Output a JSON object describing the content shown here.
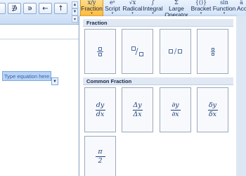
{
  "ribbon": {
    "symbols": [
      "∌",
      "∍",
      "←",
      "↑"
    ],
    "structures": [
      {
        "label": "Fraction",
        "icon": "x/y",
        "active": true
      },
      {
        "label": "Script",
        "icon": "eˣ"
      },
      {
        "label": "Radical",
        "icon": "√x"
      },
      {
        "label": "Integral",
        "icon": "∫"
      },
      {
        "label": "Large",
        "label2": "Operator",
        "icon": "Σ"
      },
      {
        "label": "Bracket",
        "icon": "{()}"
      },
      {
        "label": "Function",
        "icon": "sin"
      },
      {
        "label": "Acc",
        "icon": "ä"
      }
    ]
  },
  "document": {
    "equation_placeholder": "Type equation here."
  },
  "gallery": {
    "sections": [
      {
        "title": "Fraction"
      },
      {
        "title": "Common Fraction"
      }
    ],
    "common_fractions": [
      {
        "num": "dy",
        "den": "dx"
      },
      {
        "num": "Δy",
        "den": "Δx"
      },
      {
        "num": "∂y",
        "den": "∂x"
      },
      {
        "num": "δy",
        "den": "δx"
      },
      {
        "num": "π",
        "den": "2"
      }
    ],
    "skewed_slash": "/",
    "linear_slash": "/"
  },
  "colors": {
    "accent_active": "#ffc24a",
    "equation_box": "#b6d3f7",
    "ribbon_bg": "#d7e6f9"
  }
}
